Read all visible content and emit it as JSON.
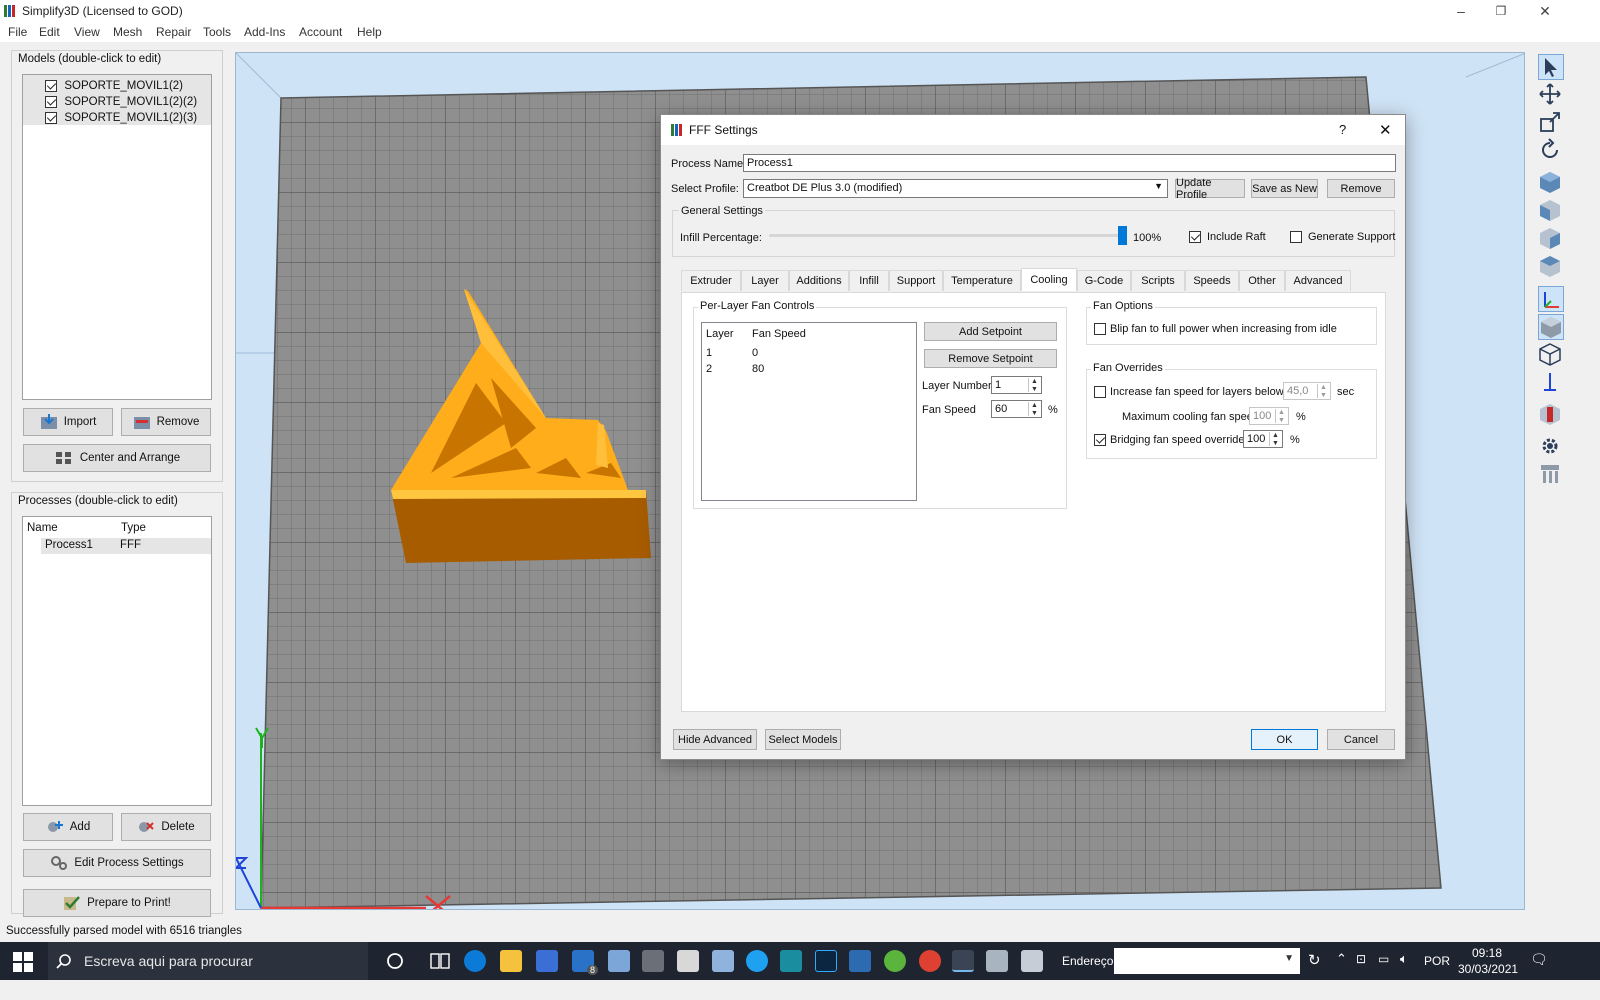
{
  "window": {
    "title": "Simplify3D (Licensed to GOD)"
  },
  "menu": [
    "File",
    "Edit",
    "View",
    "Mesh",
    "Repair",
    "Tools",
    "Add-Ins",
    "Account",
    "Help"
  ],
  "models": {
    "label": "Models (double-click to edit)",
    "items": [
      "SOPORTE_MOVIL1(2)",
      "SOPORTE_MOVIL1(2)(2)",
      "SOPORTE_MOVIL1(2)(3)"
    ],
    "import_label": "Import",
    "remove_label": "Remove",
    "center_label": "Center and Arrange"
  },
  "processes": {
    "label": "Processes (double-click to edit)",
    "col_name": "Name",
    "col_type": "Type",
    "rows": [
      {
        "name": "Process1",
        "type": "FFF"
      }
    ],
    "add_label": "Add",
    "delete_label": "Delete",
    "edit_label": "Edit Process Settings",
    "prepare_label": "Prepare to Print!"
  },
  "status": "Successfully parsed model with 6516 triangles",
  "dialog": {
    "title": "FFF Settings",
    "help": "?",
    "close": "✕",
    "process_name_label": "Process Name:",
    "process_name": "Process1",
    "select_profile_label": "Select Profile:",
    "profile": "Creatbot DE Plus 3.0 (modified)",
    "update_profile": "Update Profile",
    "save_as_new": "Save as New",
    "remove": "Remove",
    "general_settings": "General Settings",
    "infill_label": "Infill Percentage:",
    "infill_value": "100%",
    "infill_fraction": 1.0,
    "include_raft": "Include Raft",
    "generate_support": "Generate Support",
    "tabs": [
      "Extruder",
      "Layer",
      "Additions",
      "Infill",
      "Support",
      "Temperature",
      "Cooling",
      "G-Code",
      "Scripts",
      "Speeds",
      "Other",
      "Advanced"
    ],
    "active_tab": "Cooling",
    "per_layer_label": "Per-Layer Fan Controls",
    "col_layer": "Layer",
    "col_fan": "Fan Speed",
    "setpoints": [
      {
        "layer": "1",
        "speed": "0"
      },
      {
        "layer": "2",
        "speed": "80"
      }
    ],
    "add_setpoint": "Add Setpoint",
    "remove_setpoint": "Remove Setpoint",
    "layer_number_label": "Layer Number",
    "layer_number": "1",
    "fan_speed_label": "Fan Speed",
    "fan_speed": "60",
    "pct": "%",
    "fan_options_label": "Fan Options",
    "blip_label": "Blip fan to full power when increasing from idle",
    "fan_overrides_label": "Fan Overrides",
    "increase_label": "Increase fan speed for layers below",
    "increase_value": "45,0",
    "sec": "sec",
    "max_cooling_label": "Maximum cooling fan speed",
    "max_cooling_value": "100",
    "bridging_label": "Bridging fan speed override",
    "bridging_value": "100",
    "hide_advanced": "Hide Advanced",
    "select_models": "Select Models",
    "ok": "OK",
    "cancel": "Cancel"
  },
  "taskbar": {
    "search_placeholder": "Escreva aqui para procurar",
    "address_label": "Endereço",
    "language": "POR",
    "time": "09:18",
    "date": "30/03/2021",
    "mail_badge": "8"
  }
}
